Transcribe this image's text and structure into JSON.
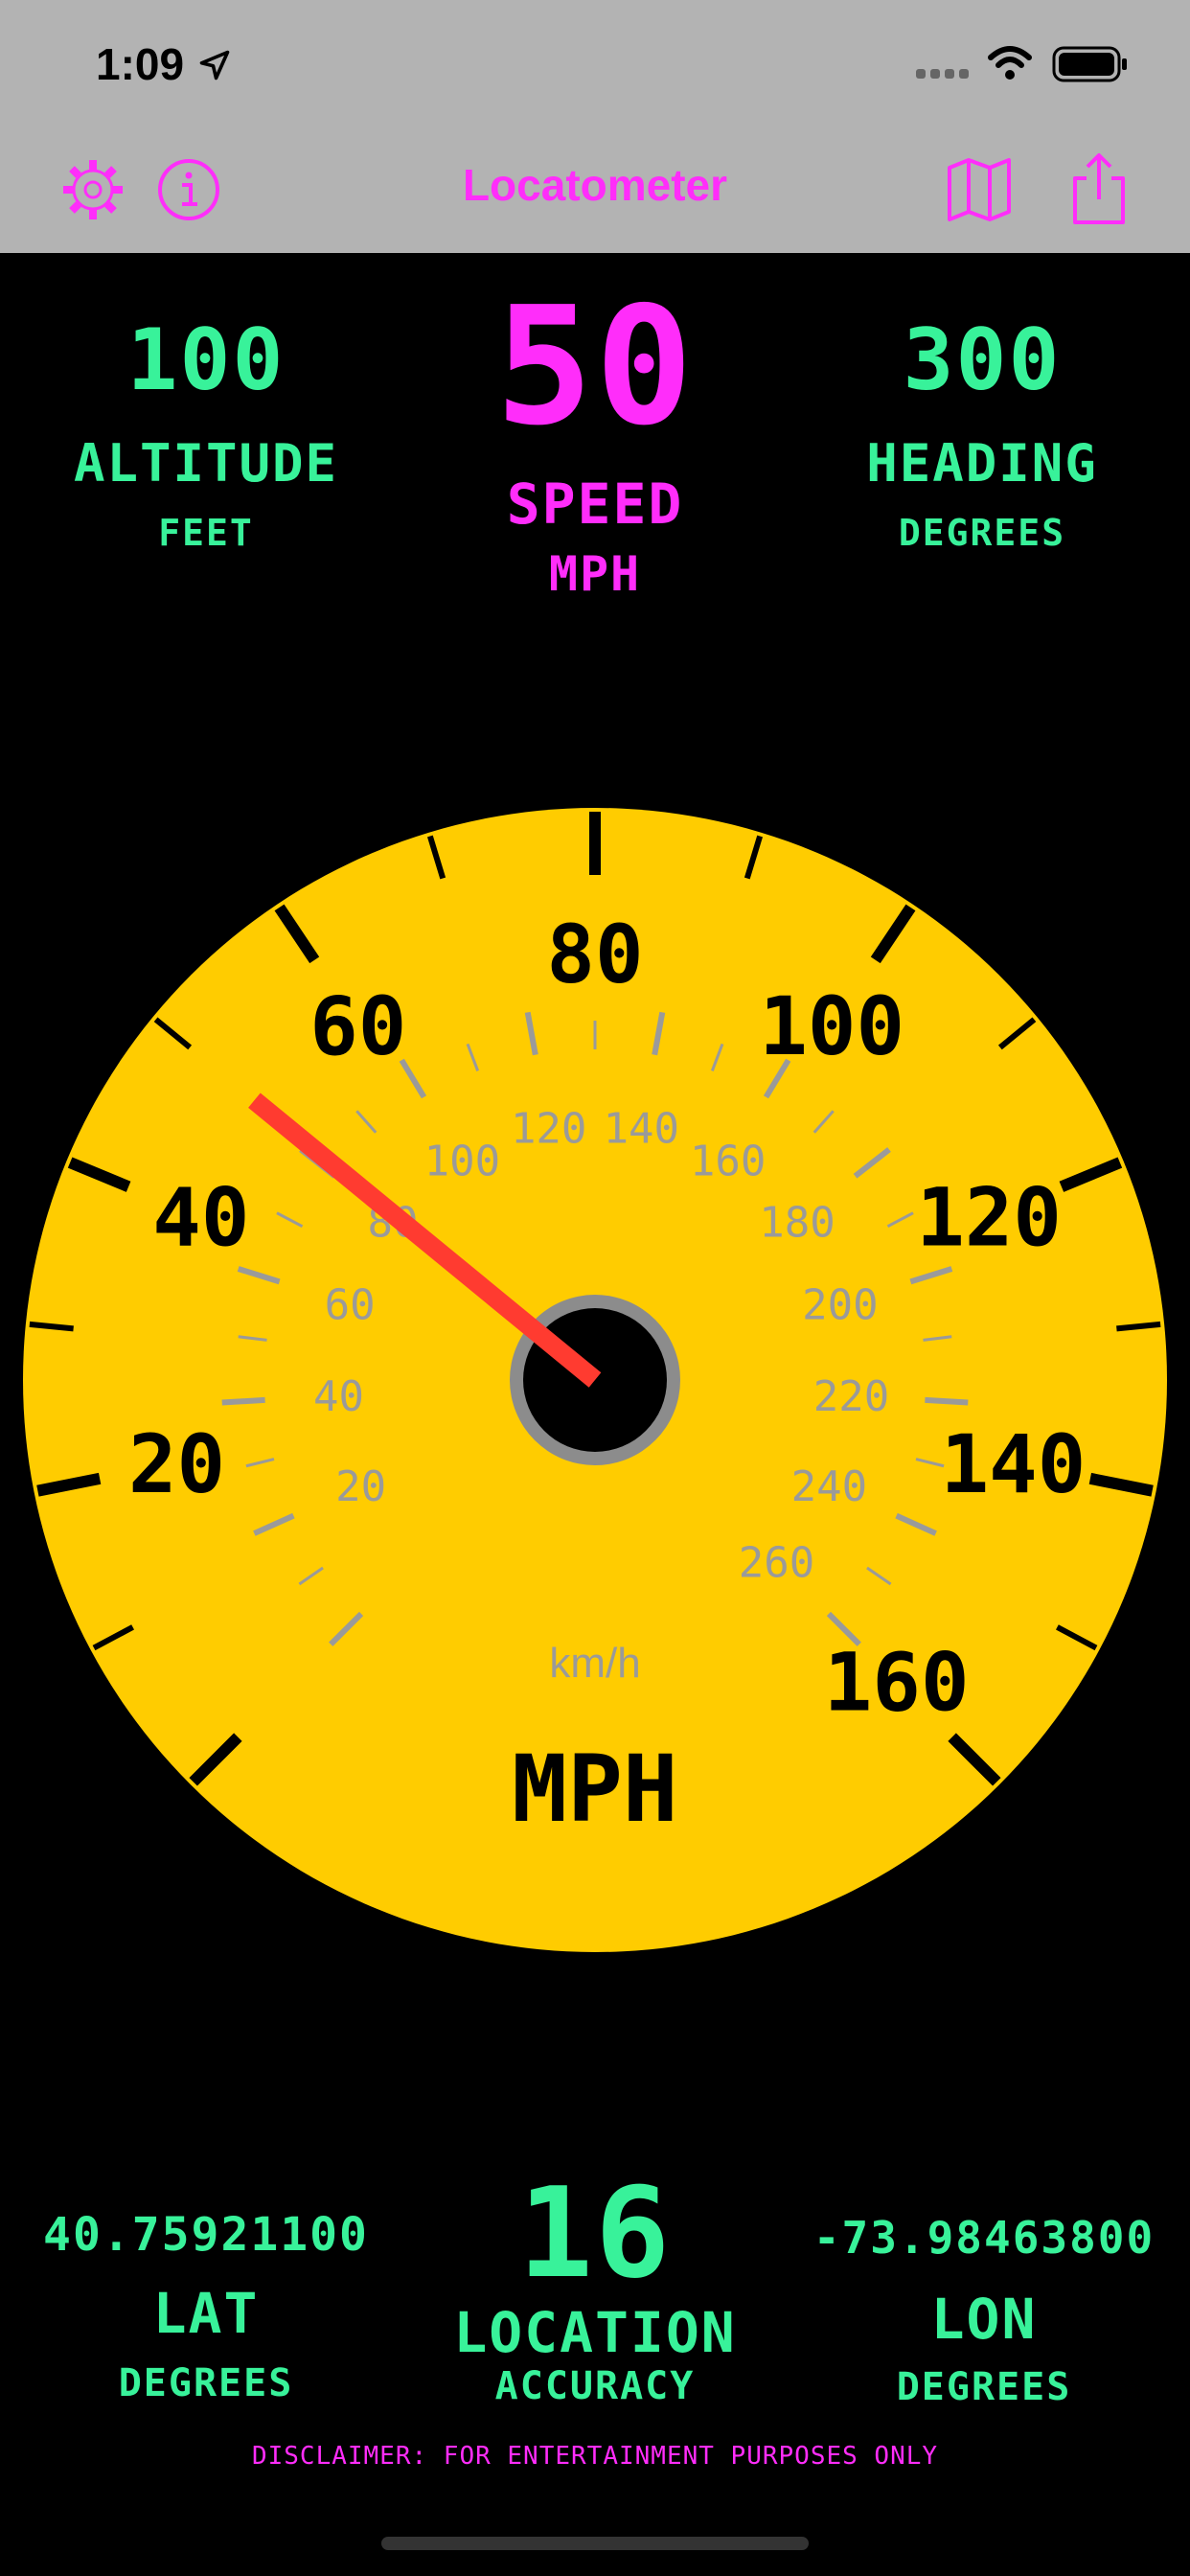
{
  "status": {
    "time": "1:09"
  },
  "nav": {
    "title": "Locatometer"
  },
  "readouts": {
    "altitude": {
      "value": "100",
      "label": "ALTITUDE",
      "unit": "FEET"
    },
    "speed": {
      "value": "50",
      "label": "SPEED",
      "unit": "MPH"
    },
    "heading": {
      "value": "300",
      "label": "HEADING",
      "unit": "DEGREES"
    },
    "lat": {
      "value": "40.75921100",
      "label": "LAT",
      "unit": "DEGREES"
    },
    "accuracy": {
      "value": "16",
      "label": "LOCATION",
      "unit": "ACCURACY"
    },
    "lon": {
      "value": "-73.98463800",
      "label": "LON",
      "unit": "DEGREES"
    }
  },
  "gauge": {
    "mph_labels": [
      "20",
      "40",
      "60",
      "80",
      "100",
      "120",
      "140",
      "160"
    ],
    "kmh_labels": [
      "20",
      "40",
      "60",
      "80",
      "100",
      "120",
      "140",
      "160",
      "180",
      "200",
      "220",
      "240",
      "260"
    ],
    "unit_outer": "MPH",
    "unit_inner": "km/h",
    "needle_mph": 50,
    "face_color": "#ffcc00",
    "needle_color": "#ff3b30"
  },
  "disclaimer": "DISCLAIMER: FOR ENTERTAINMENT PURPOSES ONLY",
  "icons": [
    "gear-icon",
    "info-icon",
    "map-icon",
    "share-icon",
    "location-arrow-icon",
    "wifi-icon",
    "battery-icon",
    "signal-icon"
  ]
}
